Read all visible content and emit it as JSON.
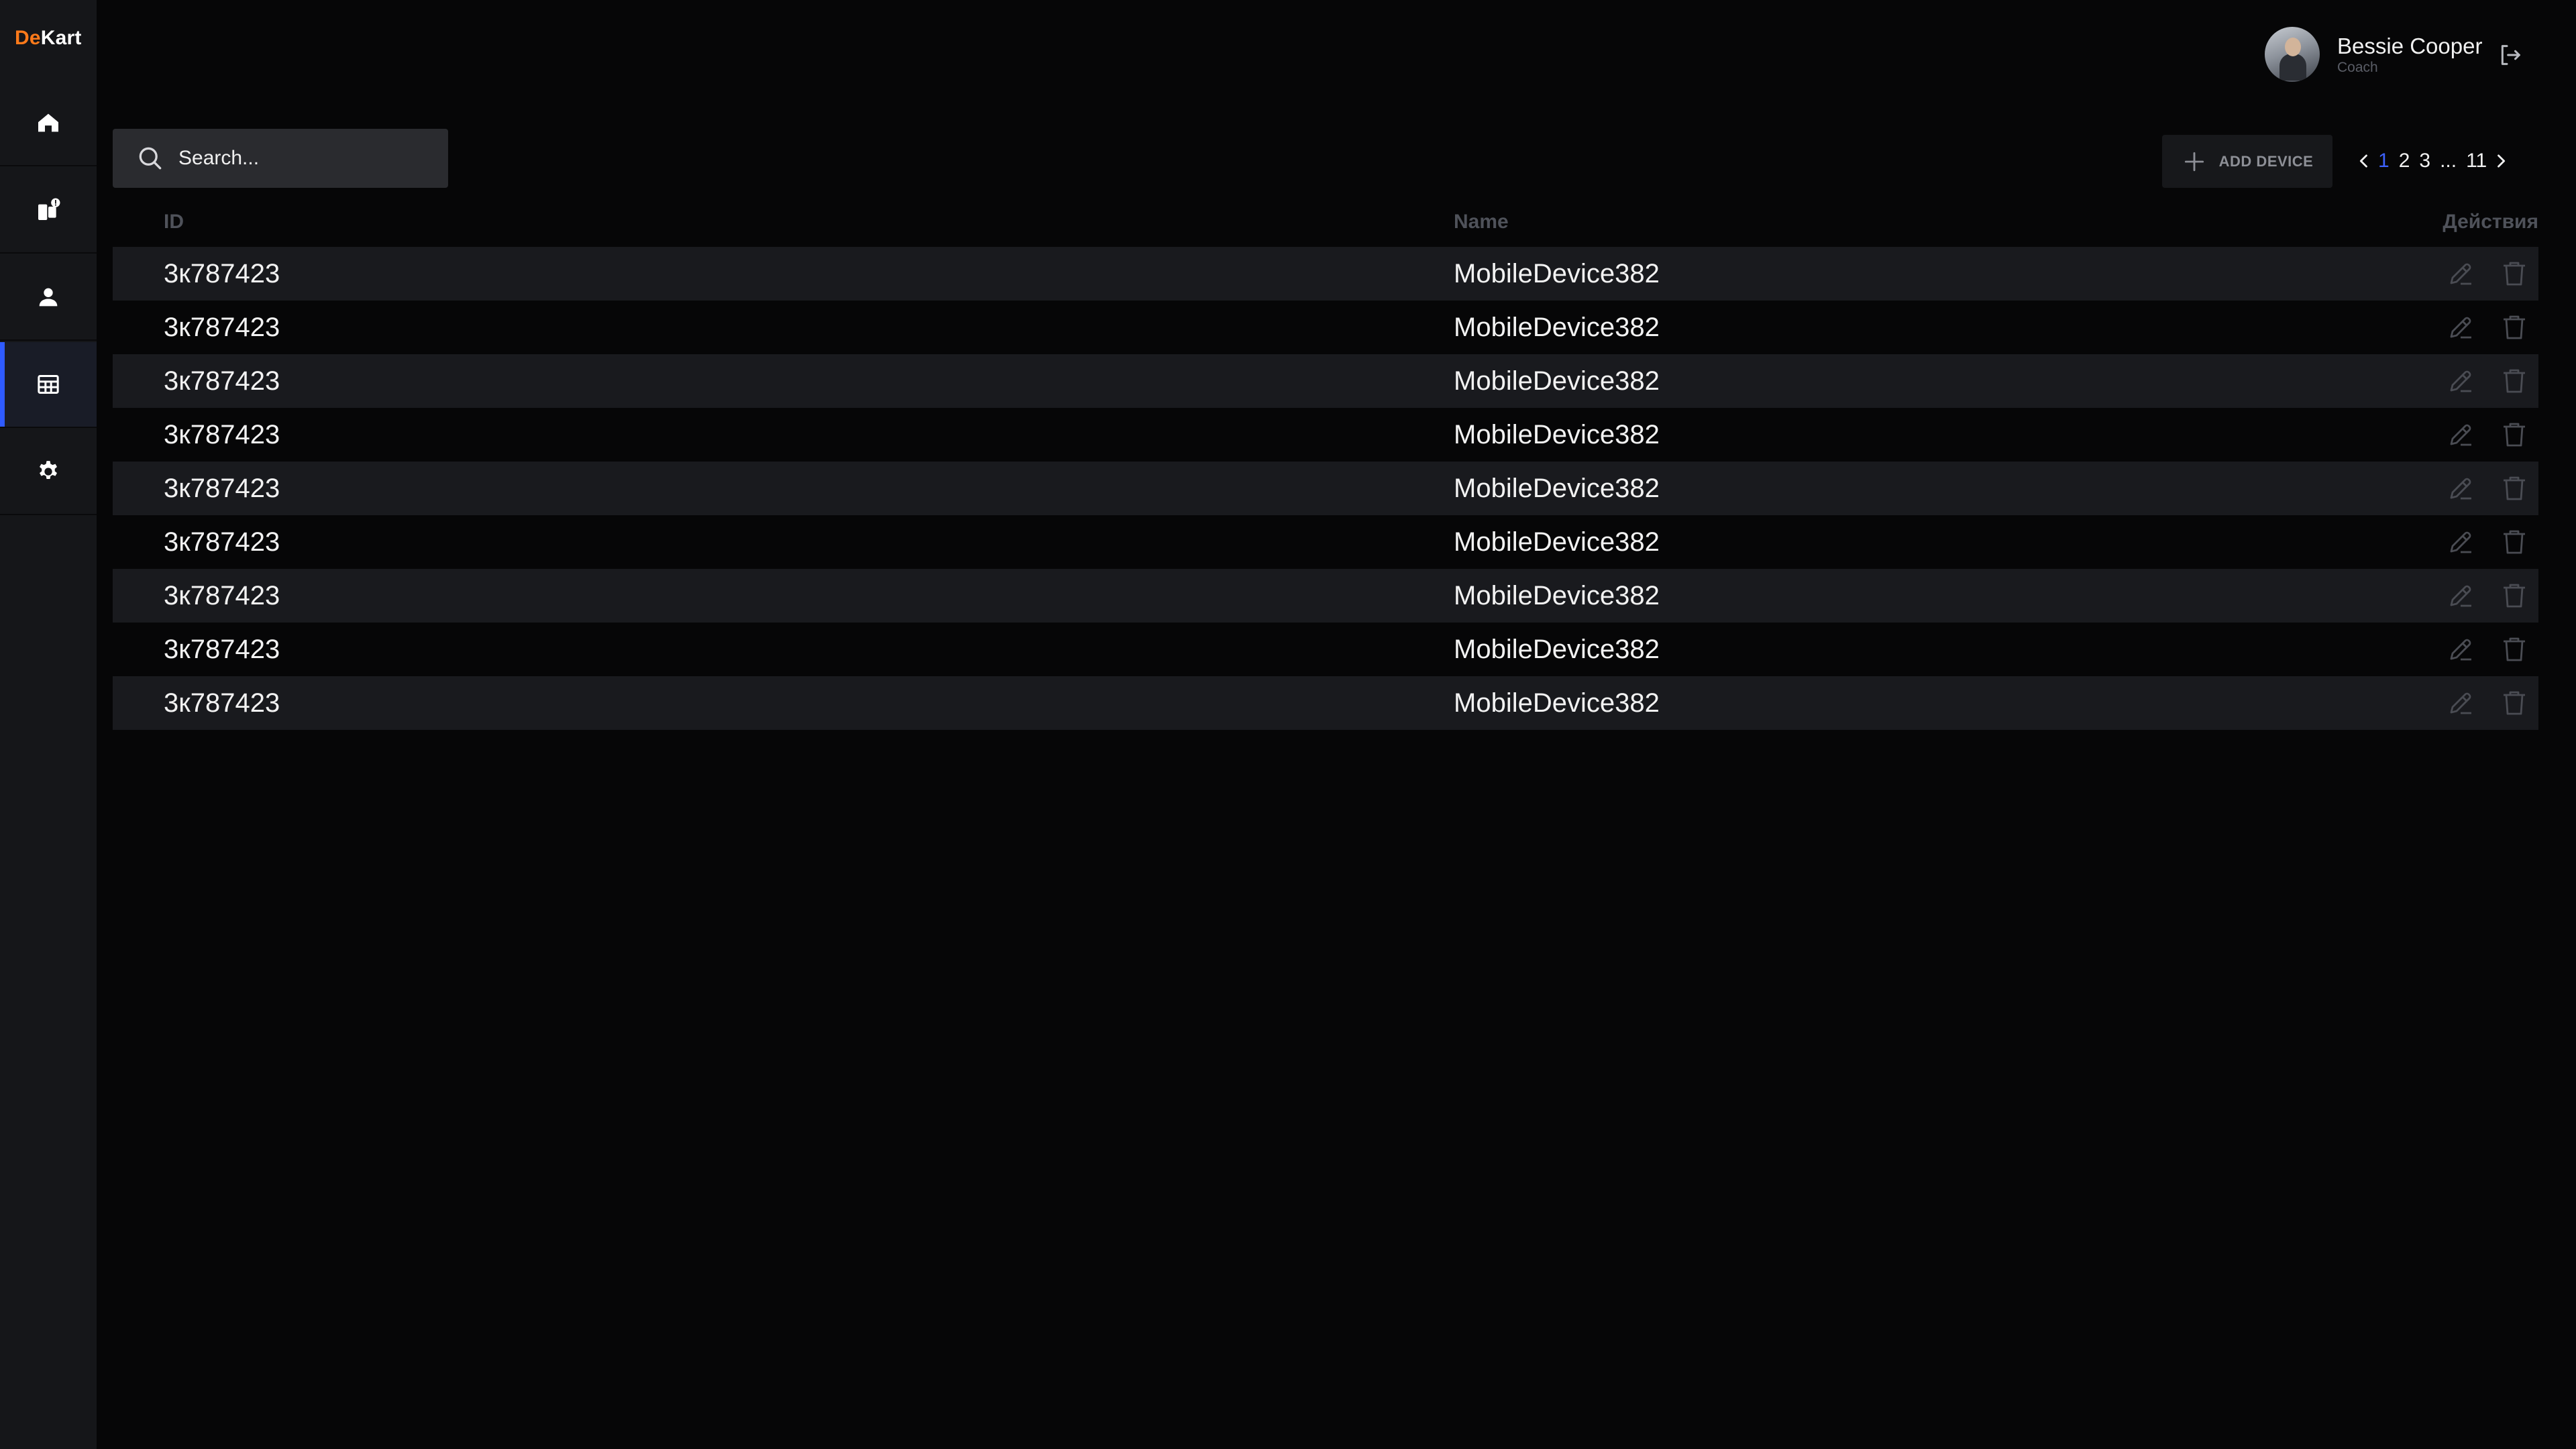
{
  "brand": {
    "part1": "De",
    "part2": "Kart",
    "accent": "#ff7a1a"
  },
  "sidebar": {
    "items": [
      {
        "icon": "home-icon",
        "active": false
      },
      {
        "icon": "devices-badge-icon",
        "active": false
      },
      {
        "icon": "user-icon",
        "active": false
      },
      {
        "icon": "table-icon",
        "active": true
      },
      {
        "icon": "gear-icon",
        "active": false
      }
    ],
    "active_color": "#2f5bff"
  },
  "user": {
    "name": "Bessie Cooper",
    "role": "Coach",
    "logout_icon": "logout-icon"
  },
  "search": {
    "placeholder": "Search..."
  },
  "toolbar": {
    "add_label": "ADD DEVICE"
  },
  "pagination": {
    "pages": [
      "1",
      "2",
      "3",
      "...",
      "11"
    ],
    "current": "1"
  },
  "table": {
    "headers": {
      "id": "ID",
      "name": "Name",
      "actions": "Действия"
    },
    "rows": [
      {
        "id": "3к787423",
        "name": "MobileDevice382"
      },
      {
        "id": "3к787423",
        "name": "MobileDevice382"
      },
      {
        "id": "3к787423",
        "name": "MobileDevice382"
      },
      {
        "id": "3к787423",
        "name": "MobileDevice382"
      },
      {
        "id": "3к787423",
        "name": "MobileDevice382"
      },
      {
        "id": "3к787423",
        "name": "MobileDevice382"
      },
      {
        "id": "3к787423",
        "name": "MobileDevice382"
      },
      {
        "id": "3к787423",
        "name": "MobileDevice382"
      },
      {
        "id": "3к787423",
        "name": "MobileDevice382"
      }
    ]
  }
}
